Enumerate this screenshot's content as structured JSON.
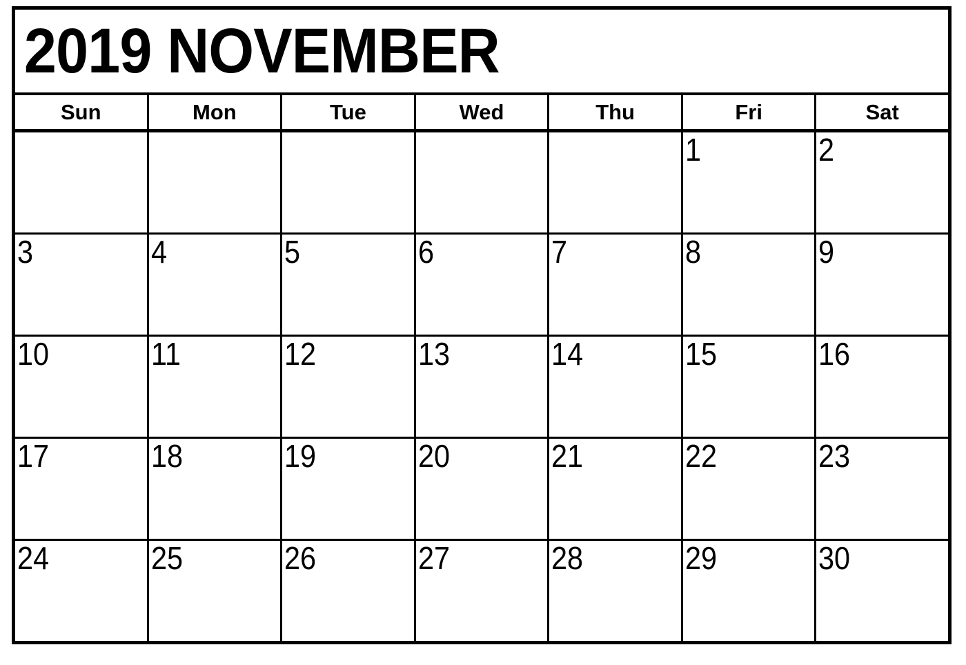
{
  "calendar": {
    "title": "2019 NOVEMBER",
    "year": "2019",
    "month": "NOVEMBER",
    "colors": {
      "ink": "#000000",
      "paper": "#ffffff"
    },
    "weekdays": [
      {
        "label": "Sun"
      },
      {
        "label": "Mon"
      },
      {
        "label": "Tue"
      },
      {
        "label": "Wed"
      },
      {
        "label": "Thu"
      },
      {
        "label": "Fri"
      },
      {
        "label": "Sat"
      }
    ],
    "weeks": [
      [
        {
          "day": ""
        },
        {
          "day": ""
        },
        {
          "day": ""
        },
        {
          "day": ""
        },
        {
          "day": ""
        },
        {
          "day": "1"
        },
        {
          "day": "2"
        }
      ],
      [
        {
          "day": "3"
        },
        {
          "day": "4"
        },
        {
          "day": "5"
        },
        {
          "day": "6"
        },
        {
          "day": "7"
        },
        {
          "day": "8"
        },
        {
          "day": "9"
        }
      ],
      [
        {
          "day": "10"
        },
        {
          "day": "11"
        },
        {
          "day": "12"
        },
        {
          "day": "13"
        },
        {
          "day": "14"
        },
        {
          "day": "15"
        },
        {
          "day": "16"
        }
      ],
      [
        {
          "day": "17"
        },
        {
          "day": "18"
        },
        {
          "day": "19"
        },
        {
          "day": "20"
        },
        {
          "day": "21"
        },
        {
          "day": "22"
        },
        {
          "day": "23"
        }
      ],
      [
        {
          "day": "24"
        },
        {
          "day": "25"
        },
        {
          "day": "26"
        },
        {
          "day": "27"
        },
        {
          "day": "28"
        },
        {
          "day": "29"
        },
        {
          "day": "30"
        }
      ]
    ]
  }
}
